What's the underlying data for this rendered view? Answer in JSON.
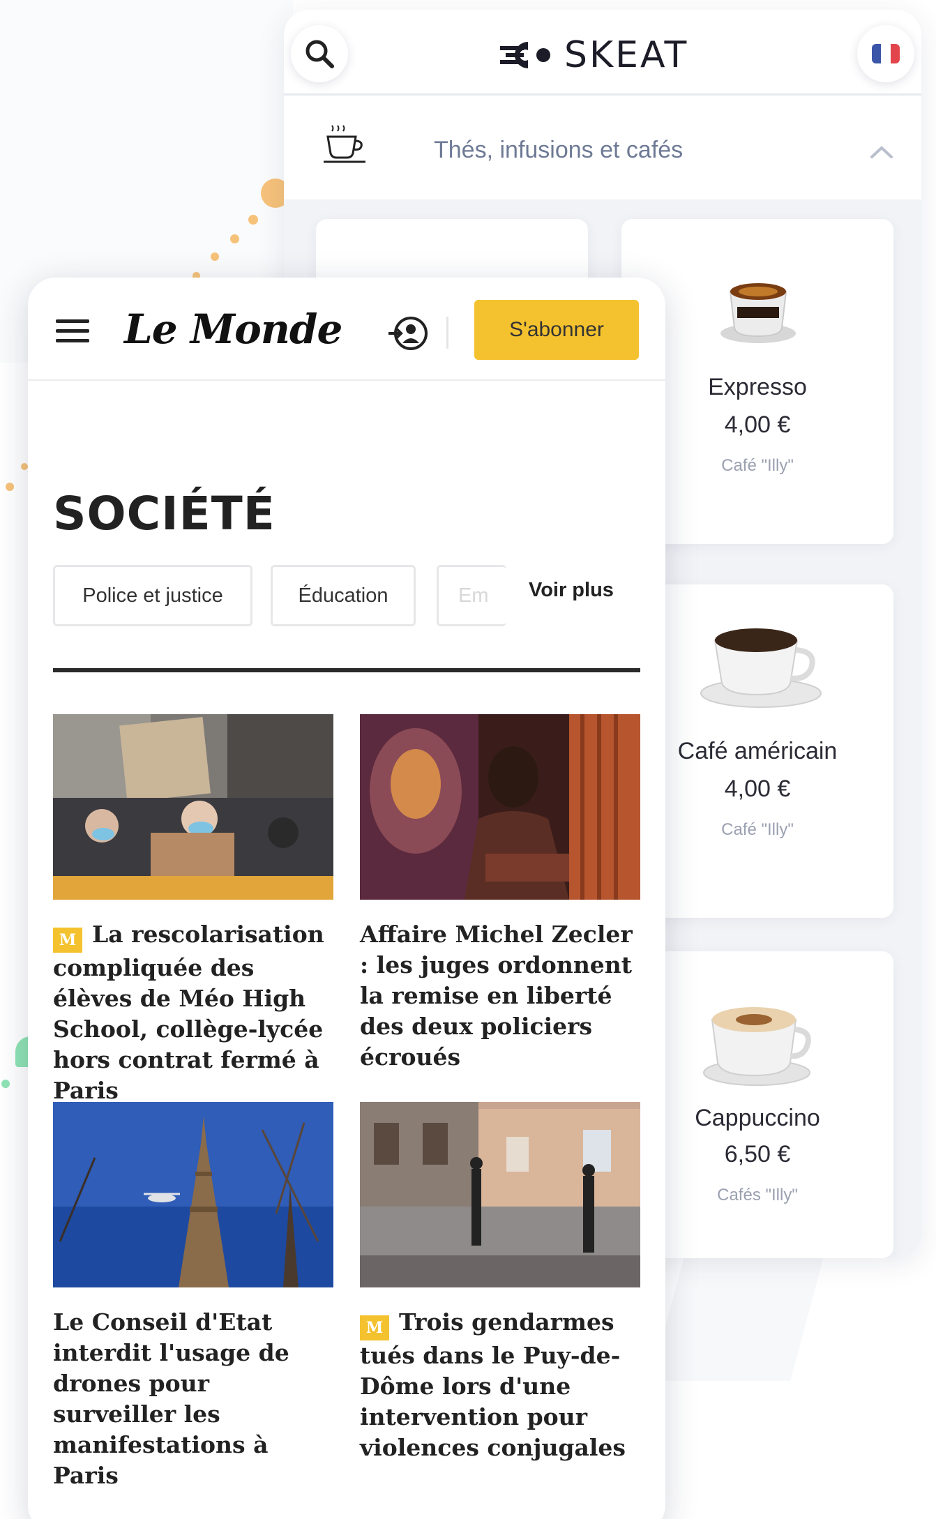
{
  "skeat": {
    "brand": "SKEAT",
    "category": "Thés, infusions et cafés",
    "products": [
      {
        "name": "Expresso",
        "price": "4,00 €",
        "sub": "Café \"Illy\""
      },
      {
        "name": "Café américain",
        "price": "4,00 €",
        "sub": "Café \"Illy\""
      },
      {
        "name": "Cappuccino",
        "price": "6,50 €",
        "sub": "Cafés \"Illy\""
      }
    ],
    "icons": {
      "search": "search-icon",
      "flag": "french-flag-icon",
      "cup": "coffee-cup-icon",
      "collapse": "chevron-up-icon"
    },
    "colors": {
      "accent": "#6e7a95",
      "background": "#f2f3f7"
    }
  },
  "lemonde": {
    "logo": "Le Monde",
    "subscribe": "S'abonner",
    "section": "SOCIÉTÉ",
    "chips": [
      "Police et justice",
      "Éducation",
      "Em"
    ],
    "more": "Voir plus",
    "badge": "M",
    "articles": [
      {
        "title": "La rescolarisation compliquée des élèves de Méo High School, collège-lycée hors contrat fermé à Paris",
        "premium": true
      },
      {
        "title": "Affaire Michel Zecler : les juges ordonnent la remise en liberté des deux policiers écroués",
        "premium": false
      },
      {
        "title": "Le Conseil d'Etat interdit l'usage de drones pour surveiller les manifestations à Paris",
        "premium": false
      },
      {
        "title": "Trois gendarmes tués dans le Puy-de-Dôme lors d'une intervention pour violences conjugales",
        "premium": true
      }
    ],
    "colors": {
      "subscribe": "#f4c22e",
      "text": "#222222"
    }
  }
}
